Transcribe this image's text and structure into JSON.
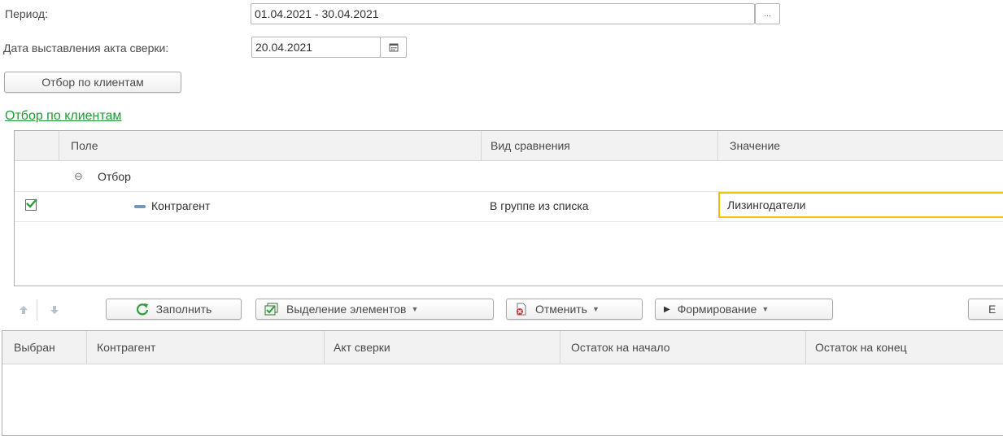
{
  "period": {
    "label": "Период:",
    "value": "01.04.2021 - 30.04.2021",
    "button_label": "..."
  },
  "act_date": {
    "label": "Дата выставления акта сверки:",
    "value": "20.04.2021"
  },
  "filter_button_label": "Отбор по клиентам",
  "filter_link": "Отбор по клиентам",
  "filter_table": {
    "columns": [
      "Поле",
      "Вид сравнения",
      "Значение"
    ],
    "group_row": {
      "label": "Отбор"
    },
    "rows": [
      {
        "checked": true,
        "field": "Контрагент",
        "comparison": "В группе из списка",
        "value": "Лизингодатели"
      }
    ]
  },
  "toolbar": {
    "fill_label": "Заполнить",
    "select_label": "Выделение элементов",
    "cancel_label": "Отменить",
    "form_label": "Формирование",
    "cut_label": "Е"
  },
  "main_table": {
    "columns": [
      "Выбран",
      "Контрагент",
      "Акт сверки",
      "Остаток на начало",
      "Остаток на конец"
    ]
  },
  "colors": {
    "link": "#1f9b35",
    "selected_cell_border": "#f2c200",
    "check": "#2e9e3b",
    "refresh_icon": "#2e9e3b"
  }
}
